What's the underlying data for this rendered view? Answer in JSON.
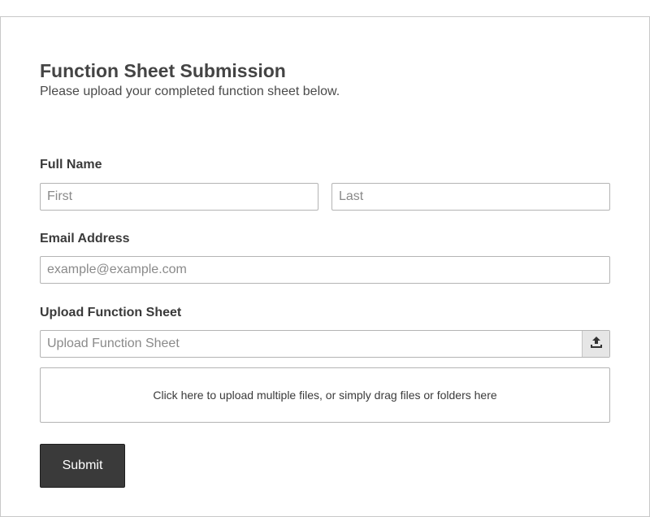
{
  "form": {
    "title": "Function Sheet Submission",
    "subtitle": "Please upload your completed function sheet below.",
    "full_name": {
      "label": "Full Name",
      "first_placeholder": "First",
      "last_placeholder": "Last"
    },
    "email": {
      "label": "Email Address",
      "placeholder": "example@example.com"
    },
    "upload": {
      "label": "Upload Function Sheet",
      "placeholder": "Upload Function Sheet",
      "button_icon": "upload-icon",
      "dropzone_text": "Click here to upload multiple files, or simply drag files or folders here"
    },
    "submit_label": "Submit"
  },
  "colors": {
    "button_bg": "#3a3a3a",
    "border": "#b4b4b4",
    "text": "#3a3a3a"
  }
}
